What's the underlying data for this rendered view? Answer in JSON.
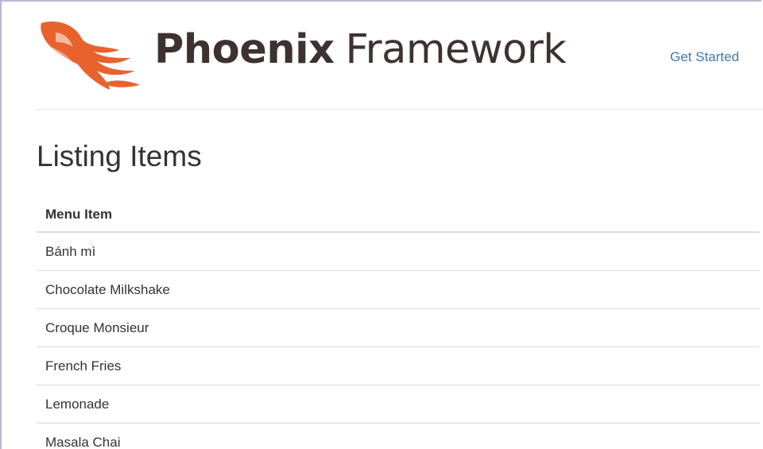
{
  "header": {
    "logo": {
      "text_strong": "Phoenix",
      "text_light": "Framework",
      "icon": "phoenix-bird-icon",
      "brand_color": "#e8622e",
      "text_color": "#3d3230"
    },
    "nav": {
      "get_started_label": "Get Started",
      "link_color": "#3f79b0"
    }
  },
  "main": {
    "title": "Listing Items",
    "table": {
      "header": "Menu Item",
      "rows": [
        {
          "name": "Bánh mì"
        },
        {
          "name": "Chocolate Milkshake"
        },
        {
          "name": "Croque Monsieur"
        },
        {
          "name": "French Fries"
        },
        {
          "name": "Lemonade"
        },
        {
          "name": "Masala Chai"
        }
      ]
    }
  }
}
